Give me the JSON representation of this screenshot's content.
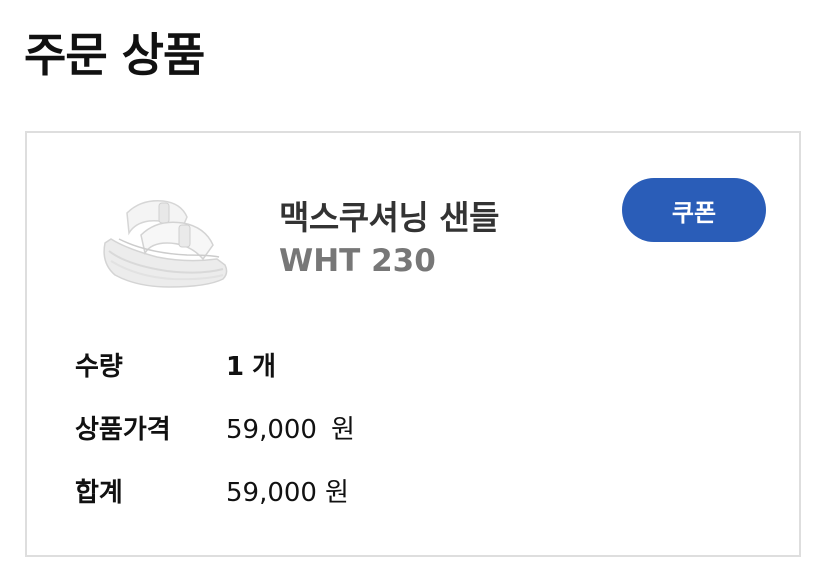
{
  "page": {
    "title": "주문 상품"
  },
  "product": {
    "name": "맥스쿠셔닝 샌들",
    "option": "WHT 230",
    "image_icon": "white-sandal-image"
  },
  "coupon_button": {
    "label": "쿠폰"
  },
  "details": {
    "quantity": {
      "label": "수량",
      "value": "1",
      "unit": "개"
    },
    "price": {
      "label": "상품가격",
      "value": "59,000",
      "unit": "원"
    },
    "total": {
      "label": "합계",
      "value": "59,000",
      "unit": "원"
    }
  },
  "colors": {
    "accent": "#2a5db8",
    "border": "#dedede",
    "option_text": "#777777"
  }
}
